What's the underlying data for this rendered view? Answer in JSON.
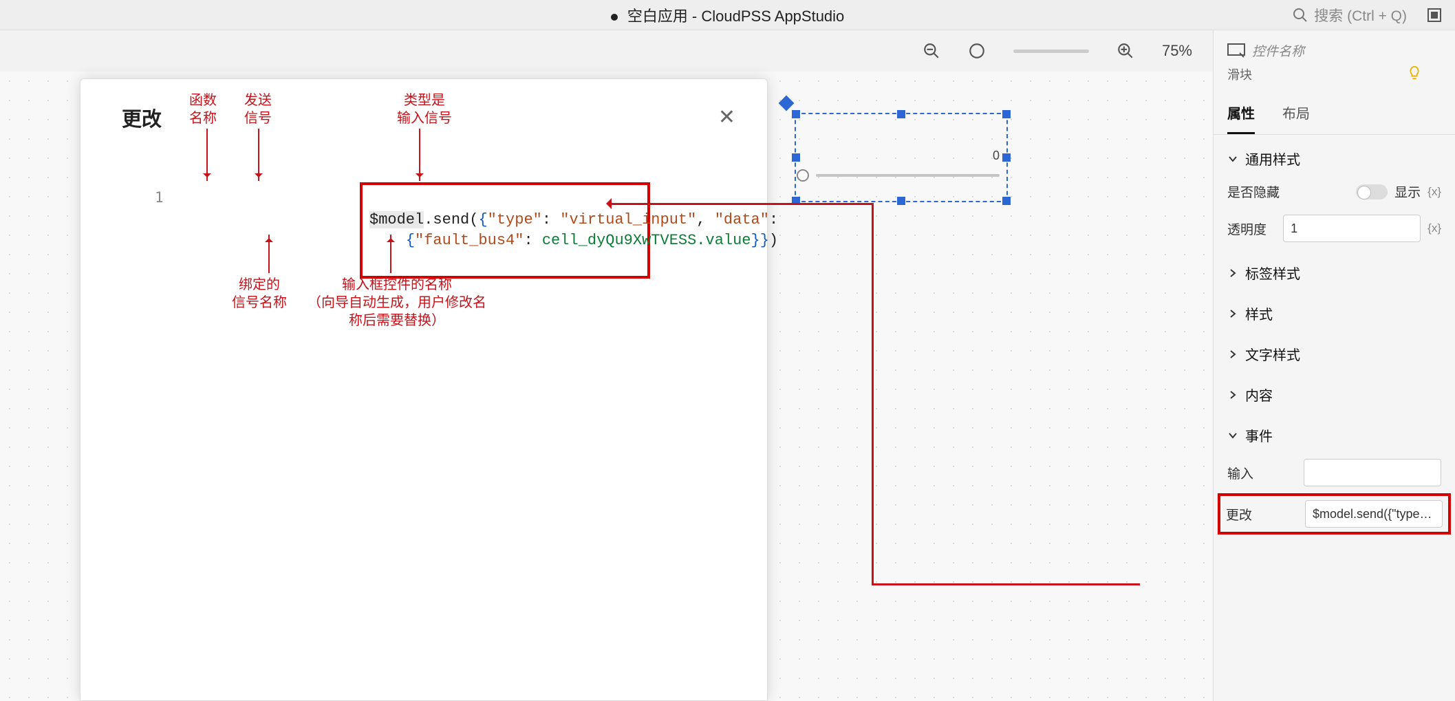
{
  "topbar": {
    "title": "空白应用 - CloudPSS AppStudio",
    "search_placeholder": "搜索 (Ctrl + Q)"
  },
  "zoom": {
    "percent": "75%"
  },
  "inspector": {
    "name_placeholder": "控件名称",
    "type_label": "滑块",
    "tabs": {
      "props": "属性",
      "layout": "布局"
    },
    "sections": {
      "general": "通用样式",
      "label_style": "标签样式",
      "style": "样式",
      "text_style": "文字样式",
      "content": "内容",
      "events": "事件"
    },
    "general": {
      "hidden_label": "是否隐藏",
      "hidden_value": "显示",
      "fx": "{x}",
      "opacity_label": "透明度",
      "opacity_value": "1"
    },
    "events": {
      "input_label": "输入",
      "input_value": "",
      "change_label": "更改",
      "change_value": "$model.send({\"type\": \"vi..."
    }
  },
  "canvas": {
    "slider_value": "0"
  },
  "modal": {
    "title": "更改",
    "line_number": "1",
    "code": {
      "model": "$model",
      "send": ".send",
      "type_key": "\"type\"",
      "type_val": "\"virtual_input\"",
      "data_key": "\"data\"",
      "signal_key": "\"fault_bus4\"",
      "cell_ref": "cell_dyQu9XwTVESS.value"
    },
    "annotations": {
      "func_name": "函数\n名称",
      "send_signal": "发送\n信号",
      "type_is_input": "类型是\n输入信号",
      "bound_signal": "绑定的\n信号名称",
      "widget_name": "输入框控件的名称\n（向导自动生成，用户修改名\n称后需要替换）"
    }
  }
}
